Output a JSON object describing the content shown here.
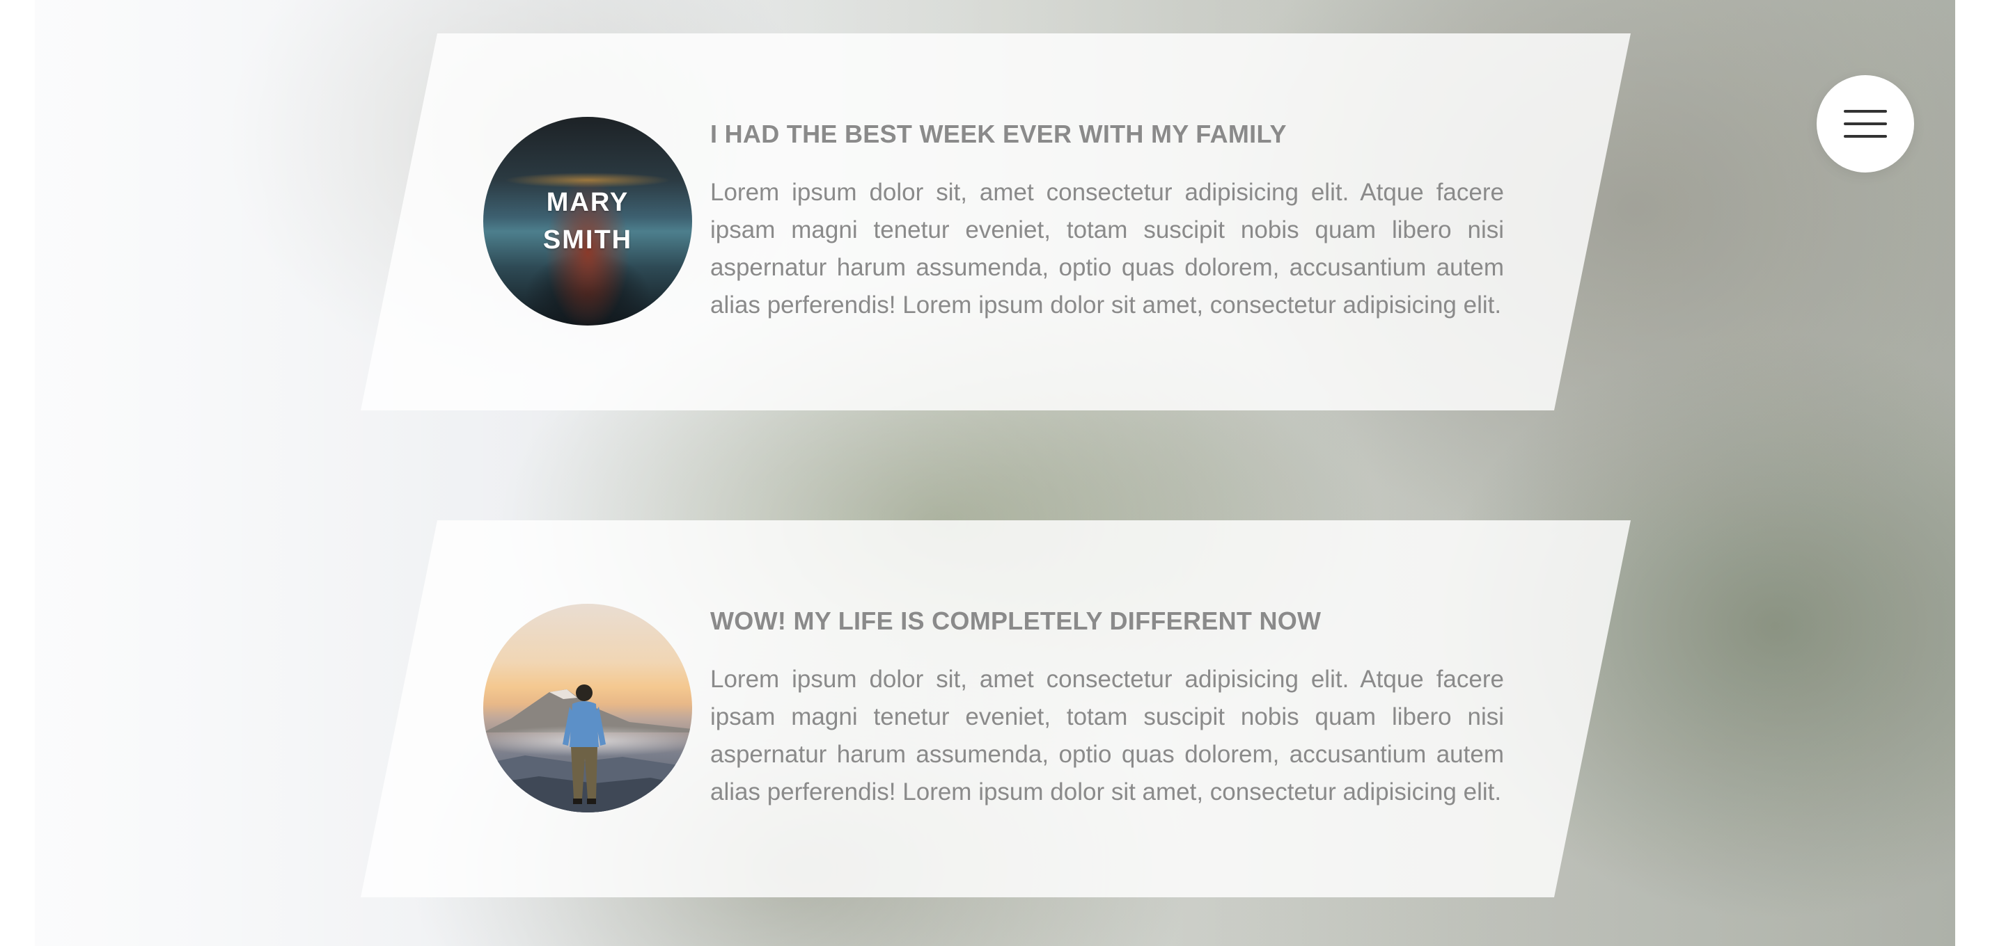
{
  "menu": {
    "icon": "hamburger-menu-icon"
  },
  "testimonials": [
    {
      "avatar_label_line1": "MARY",
      "avatar_label_line2": "SMITH",
      "avatar_image": "person-on-boat-lake-photo",
      "title": "I HAD THE BEST WEEK EVER WITH MY FAMILY",
      "text": "Lorem ipsum dolor sit, amet consectetur adipisicing elit. Atque facere ipsam magni tenetur eveniet, totam suscipit nobis quam libero nisi aspernatur harum assumenda, optio quas dolorem, accusantium autem alias perferendis! Lorem ipsum dolor sit amet, consectetur adipisicing elit."
    },
    {
      "avatar_image": "man-on-mountain-sunrise-photo",
      "title": "WOW! MY LIFE IS COMPLETELY DIFFERENT NOW",
      "text": "Lorem ipsum dolor sit, amet consectetur adipisicing elit. Atque facere ipsam magni tenetur eveniet, totam suscipit nobis quam libero nisi aspernatur harum assumenda, optio quas dolorem, accusantium autem alias perferendis! Lorem ipsum dolor sit amet, consectetur adipisicing elit."
    }
  ],
  "colors": {
    "card_text": "#8a8a8a",
    "menu_button_bg": "#ffffff",
    "menu_icon": "#333333"
  }
}
